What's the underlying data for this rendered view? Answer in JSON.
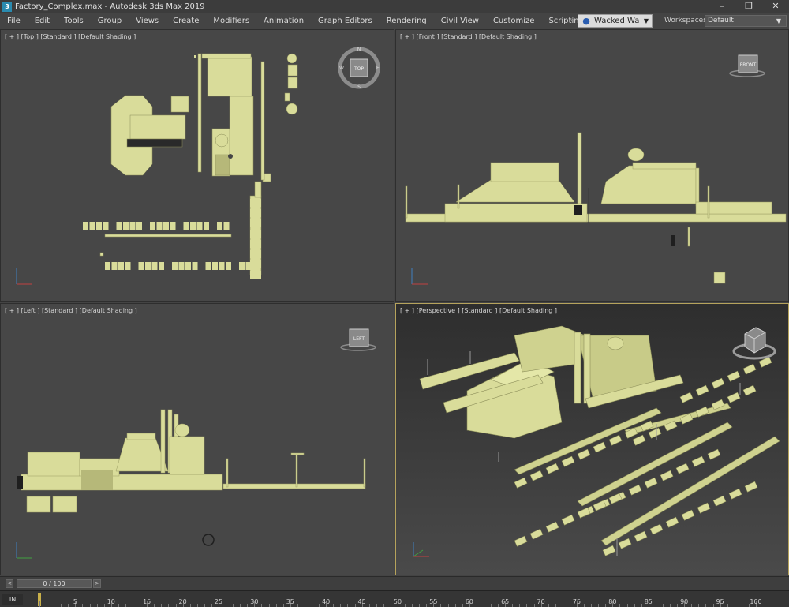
{
  "window": {
    "title": "Factory_Complex.max - Autodesk 3ds Max 2019",
    "app_icon": "3ds-max-icon",
    "controls": [
      "minimize-icon",
      "maximize-icon",
      "close-icon"
    ]
  },
  "menu": {
    "items": [
      "File",
      "Edit",
      "Tools",
      "Group",
      "Views",
      "Create",
      "Modifiers",
      "Animation",
      "Graph Editors",
      "Rendering",
      "Civil View",
      "Customize",
      "Scripting"
    ],
    "overflow": "»"
  },
  "user": {
    "name": "Wacked Wa",
    "icon": "user-icon"
  },
  "workspaces": {
    "label": "Workspaces:",
    "value": "Default"
  },
  "viewports": {
    "top": {
      "label": "[ + ] [Top ] [Standard ] [Default Shading ]",
      "cube": "TOP",
      "compass": {
        "n": "N",
        "s": "S",
        "e": "E",
        "w": "W"
      }
    },
    "front": {
      "label": "[ + ] [Front ] [Standard ] [Default Shading ]",
      "cube": "FRONT"
    },
    "left": {
      "label": "[ + ] [Left ] [Standard ] [Default Shading ]",
      "cube": "LEFT"
    },
    "perspective": {
      "label": "[ + ] [Perspective ] [Standard ] [Default Shading ]",
      "cube": ""
    }
  },
  "colors": {
    "model": "#d9dc9a",
    "model_shadow": "#a9ab72",
    "viewport_bg": "#474747",
    "active_border": "#b6a35c",
    "playhead": "#c9b04a"
  },
  "timeline": {
    "frame": "0 / 100",
    "prev": "<",
    "next": ">",
    "ruler_labels": [
      "5",
      "10",
      "15",
      "20",
      "25",
      "30",
      "35",
      "40",
      "45",
      "50",
      "55",
      "60",
      "65",
      "70",
      "75",
      "80",
      "85",
      "90",
      "95",
      "100"
    ],
    "ruler_icon": "IN"
  }
}
